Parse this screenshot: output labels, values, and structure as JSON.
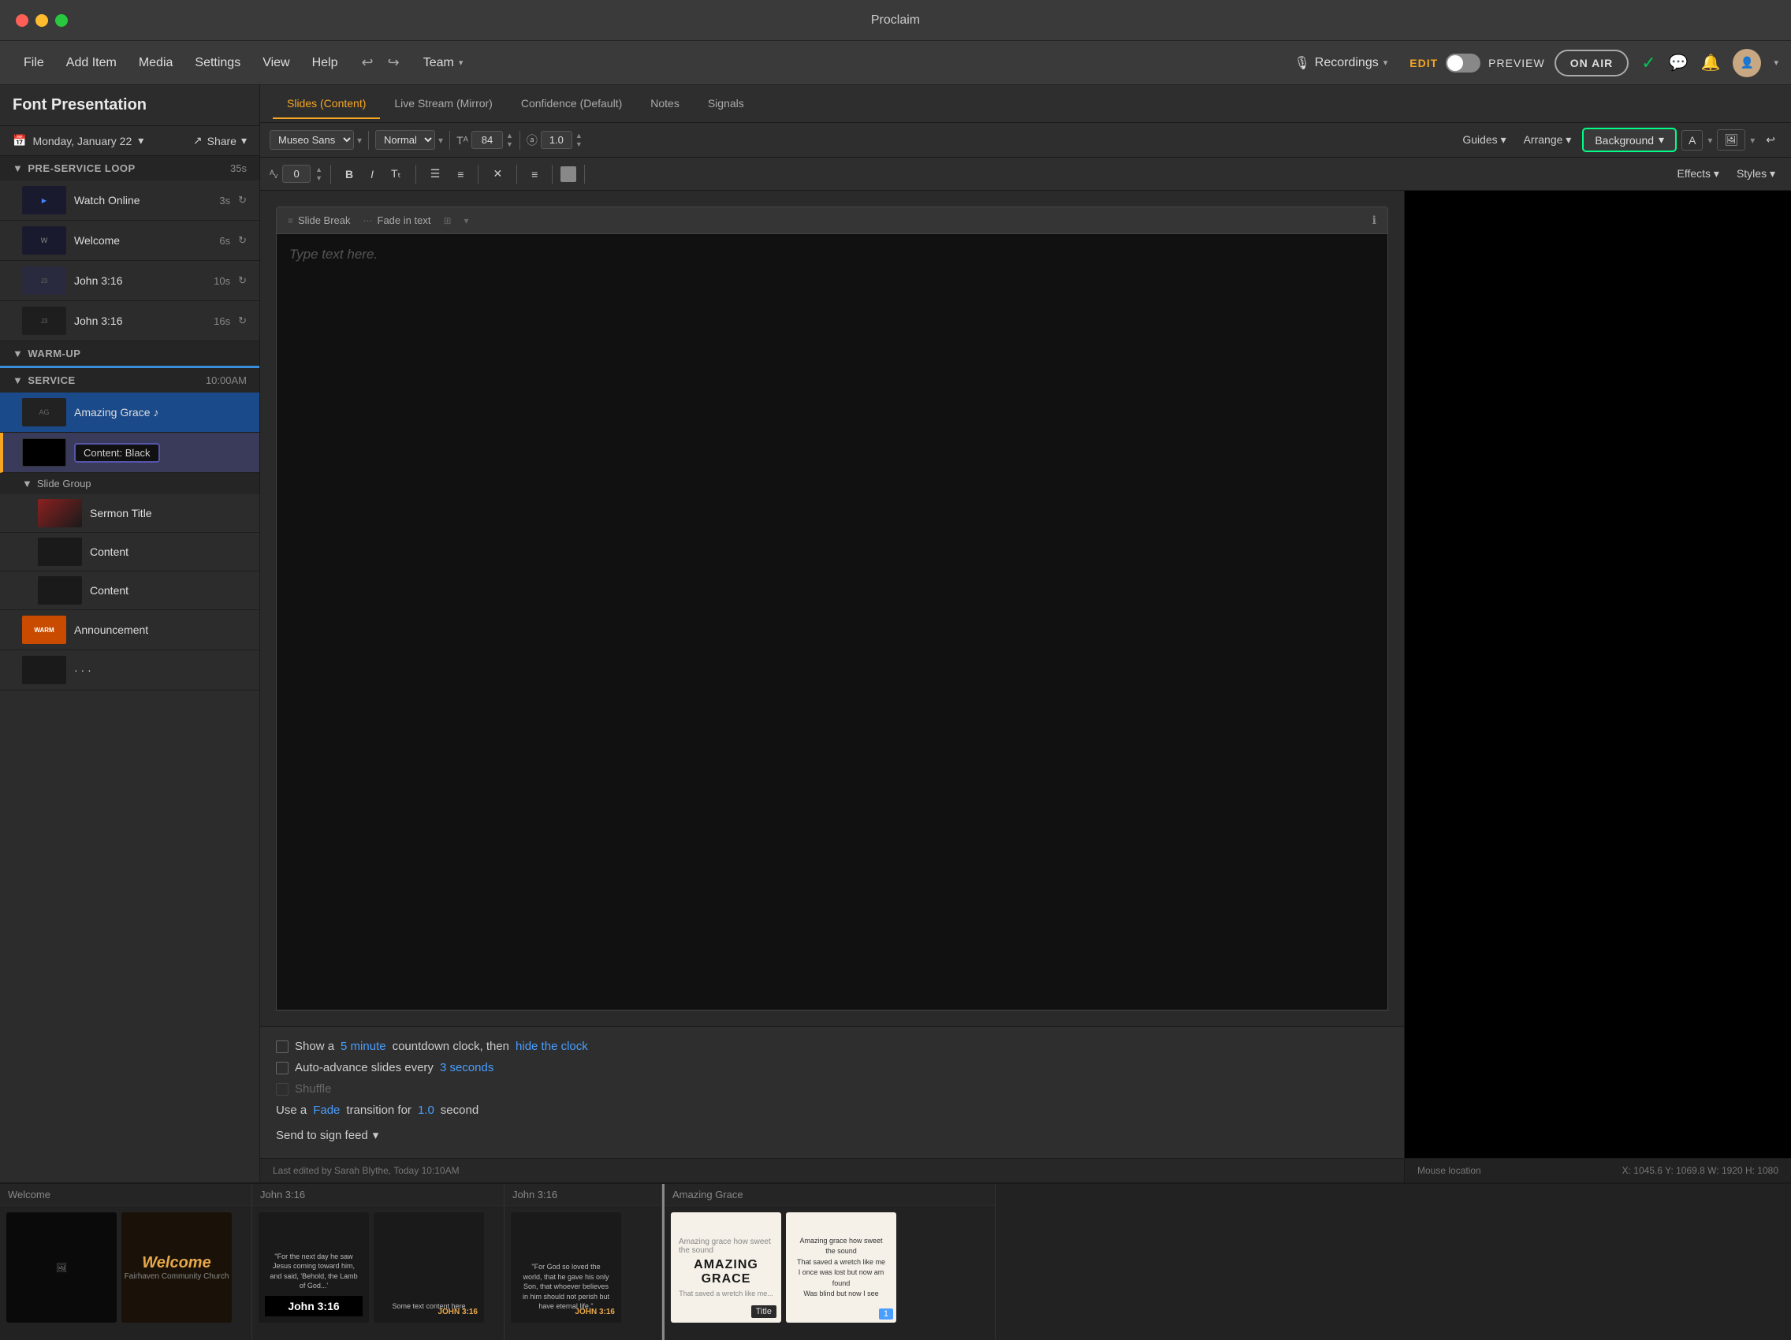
{
  "titlebar": {
    "title": "Proclaim"
  },
  "menubar": {
    "file": "File",
    "add_item": "Add Item",
    "media": "Media",
    "settings": "Settings",
    "view": "View",
    "help": "Help",
    "team": "Team",
    "recordings": "Recordings",
    "edit": "EDIT",
    "preview": "PREVIEW",
    "on_air": "ON AIR"
  },
  "tabs": {
    "slides_content": "Slides (Content)",
    "live_stream": "Live Stream (Mirror)",
    "confidence": "Confidence (Default)",
    "notes": "Notes",
    "signals": "Signals"
  },
  "toolbar1": {
    "font": "Museo Sans",
    "style": "Normal",
    "size": "84",
    "spacing": "1.0",
    "guides": "Guides",
    "arrange": "Arrange",
    "background": "Background",
    "undo": "↩",
    "redo": "↪"
  },
  "toolbar2": {
    "indent": "0",
    "bold": "B",
    "italic": "I",
    "text_transform": "Tt",
    "list": "☰",
    "align": "≡",
    "effects": "Effects",
    "styles": "Styles"
  },
  "sidebar": {
    "title": "Font Presentation",
    "date": "Monday, January 22",
    "share": "Share",
    "sections": [
      {
        "name": "PRE-SERVICE LOOP",
        "duration": "35s",
        "items": [
          {
            "label": "Watch Online",
            "duration": "3s",
            "has_sync": true
          },
          {
            "label": "Welcome",
            "duration": "6s",
            "has_sync": true
          },
          {
            "label": "John 3:16",
            "duration": "10s",
            "has_sync": true
          },
          {
            "label": "John 3:16",
            "duration": "16s",
            "has_sync": true
          }
        ]
      },
      {
        "name": "WARM-UP",
        "duration": "",
        "items": []
      },
      {
        "name": "SERVICE",
        "duration": "10:00AM",
        "items": [
          {
            "label": "Amazing Grace ♪",
            "duration": "",
            "has_sync": false,
            "is_selected": true
          },
          {
            "label": "Content: Black",
            "duration": "",
            "is_content": true
          },
          {
            "label": "Slide Group",
            "is_group": true,
            "children": [
              {
                "label": "Sermon Title",
                "type": "sermon"
              },
              {
                "label": "Content",
                "type": "content"
              },
              {
                "label": "Content",
                "type": "content"
              }
            ]
          },
          {
            "label": "Announcement",
            "duration": "",
            "type": "announcement"
          }
        ]
      }
    ]
  },
  "slide_editor": {
    "slide_break": "Slide Break",
    "fade_in_text": "Fade in text",
    "placeholder": "Type text here.",
    "show_countdown": "Show a",
    "countdown_minutes": "5 minute",
    "countdown_then": "countdown clock, then",
    "hide_clock": "hide the clock",
    "auto_advance": "Auto-advance slides every",
    "advance_seconds": "3 seconds",
    "shuffle": "Shuffle",
    "transition_use": "Use a",
    "transition_type": "Fade",
    "transition_for": "transition for",
    "transition_value": "1.0",
    "transition_unit": "second",
    "send_to_sign": "Send to sign feed",
    "last_edited": "Last edited by Sarah Blythe, Today 10:10AM"
  },
  "preview_panel": {
    "mouse_location": "Mouse location",
    "coordinates": "X: 1045.6 Y: 1069.8 W: 1920 H: 1080"
  },
  "filmstrip": {
    "sections": [
      {
        "title": "Welcome",
        "slides": [
          {
            "type": "welcome_dark",
            "label": ""
          },
          {
            "type": "welcome_light",
            "label": ""
          }
        ]
      },
      {
        "title": "John 3:16",
        "slides": [
          {
            "type": "john_text",
            "label": ""
          },
          {
            "type": "john_orange",
            "label": ""
          }
        ]
      },
      {
        "title": "John 3:16",
        "slides": [
          {
            "type": "john_quote",
            "label": ""
          }
        ]
      },
      {
        "title": "Amazing Grace",
        "slides": [
          {
            "type": "amazing_title",
            "label": "Title"
          },
          {
            "type": "amazing_verse",
            "label": "1"
          }
        ]
      }
    ]
  }
}
